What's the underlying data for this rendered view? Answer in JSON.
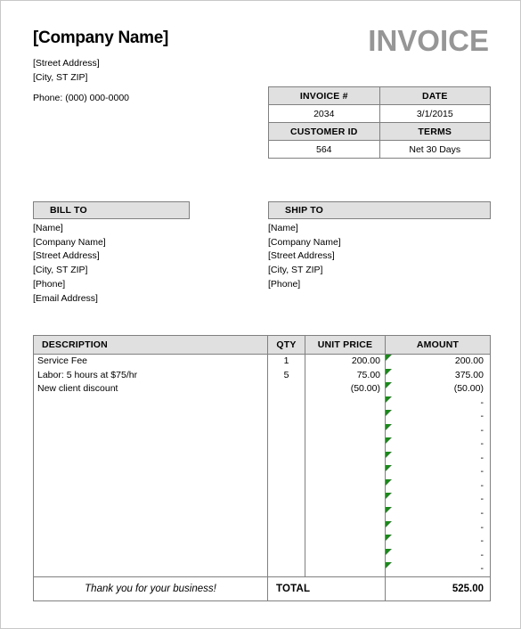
{
  "document": {
    "type": "invoice-template",
    "title": "INVOICE",
    "title_color": "#969696"
  },
  "company": {
    "name": "[Company Name]",
    "street": "[Street Address]",
    "city_state_zip": "[City, ST  ZIP]",
    "phone": "Phone: (000) 000-0000"
  },
  "meta": {
    "invoice_no_label": "INVOICE #",
    "invoice_no_value": "2034",
    "date_label": "DATE",
    "date_value": "3/1/2015",
    "customer_id_label": "CUSTOMER ID",
    "customer_id_value": "564",
    "terms_label": "TERMS",
    "terms_value": "Net 30 Days"
  },
  "bill_to": {
    "heading": "BILL TO",
    "lines": [
      "[Name]",
      "[Company Name]",
      "[Street Address]",
      "[City, ST  ZIP]",
      "[Phone]",
      "[Email Address]"
    ]
  },
  "ship_to": {
    "heading": "SHIP TO",
    "lines": [
      "[Name]",
      "[Company Name]",
      "[Street Address]",
      "[City, ST  ZIP]",
      "[Phone]"
    ]
  },
  "items_table": {
    "columns": [
      "DESCRIPTION",
      "QTY",
      "UNIT PRICE",
      "AMOUNT"
    ],
    "rows": [
      {
        "description": "Service Fee",
        "qty": "1",
        "unit_price": "200.00",
        "amount": "200.00"
      },
      {
        "description": "Labor: 5 hours at $75/hr",
        "qty": "5",
        "unit_price": "75.00",
        "amount": "375.00"
      },
      {
        "description": "New client discount",
        "qty": "",
        "unit_price": "(50.00)",
        "amount": "(50.00)"
      },
      {
        "description": "",
        "qty": "",
        "unit_price": "",
        "amount": "-"
      },
      {
        "description": "",
        "qty": "",
        "unit_price": "",
        "amount": "-"
      },
      {
        "description": "",
        "qty": "",
        "unit_price": "",
        "amount": "-"
      },
      {
        "description": "",
        "qty": "",
        "unit_price": "",
        "amount": "-"
      },
      {
        "description": "",
        "qty": "",
        "unit_price": "",
        "amount": "-"
      },
      {
        "description": "",
        "qty": "",
        "unit_price": "",
        "amount": "-"
      },
      {
        "description": "",
        "qty": "",
        "unit_price": "",
        "amount": "-"
      },
      {
        "description": "",
        "qty": "",
        "unit_price": "",
        "amount": "-"
      },
      {
        "description": "",
        "qty": "",
        "unit_price": "",
        "amount": "-"
      },
      {
        "description": "",
        "qty": "",
        "unit_price": "",
        "amount": "-"
      },
      {
        "description": "",
        "qty": "",
        "unit_price": "",
        "amount": "-"
      },
      {
        "description": "",
        "qty": "",
        "unit_price": "",
        "amount": "-"
      },
      {
        "description": "",
        "qty": "",
        "unit_price": "",
        "amount": "-"
      }
    ],
    "error_indicator": "green-triangle-error-icon",
    "error_indicator_color": "#1a8a1a"
  },
  "footer": {
    "thanks": "Thank you for your business!",
    "total_label": "TOTAL",
    "total_value": "525.00"
  },
  "colors": {
    "header_fill": "#e0e0e0",
    "border": "#808080",
    "page_border": "#c8c8c8"
  }
}
